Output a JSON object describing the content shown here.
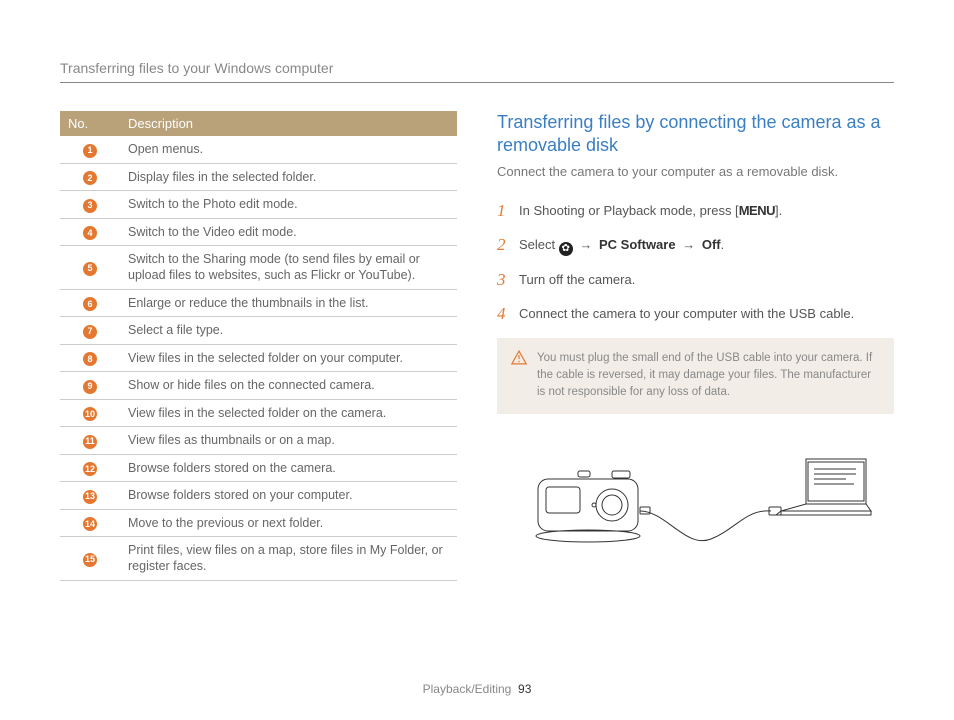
{
  "header_title": "Transferring files to your Windows computer",
  "table": {
    "headers": [
      "No.",
      "Description"
    ],
    "rows": [
      {
        "n": "1",
        "desc": "Open menus."
      },
      {
        "n": "2",
        "desc": "Display files in the selected folder."
      },
      {
        "n": "3",
        "desc": "Switch to the Photo edit mode."
      },
      {
        "n": "4",
        "desc": "Switch to the Video edit mode."
      },
      {
        "n": "5",
        "desc": "Switch to the Sharing mode (to send files by email or upload files to websites, such as Flickr or YouTube)."
      },
      {
        "n": "6",
        "desc": "Enlarge or reduce the thumbnails in the list."
      },
      {
        "n": "7",
        "desc": "Select a file type."
      },
      {
        "n": "8",
        "desc": "View files in the selected folder on your computer."
      },
      {
        "n": "9",
        "desc": "Show or hide files on the connected camera."
      },
      {
        "n": "10",
        "desc": "View files in the selected folder on the camera."
      },
      {
        "n": "11",
        "desc": "View files as thumbnails or on a map."
      },
      {
        "n": "12",
        "desc": "Browse folders stored on the camera."
      },
      {
        "n": "13",
        "desc": "Browse folders stored on your computer."
      },
      {
        "n": "14",
        "desc": "Move to the previous or next folder."
      },
      {
        "n": "15",
        "desc": "Print files, view files on a map, store files in My Folder, or register faces."
      }
    ]
  },
  "section": {
    "heading": "Transferring files by connecting the camera as a removable disk",
    "intro": "Connect the camera to your computer as a removable disk.",
    "steps": [
      {
        "n": "1",
        "pre": "In Shooting or Playback mode, press [",
        "key": "MENU",
        "post": "]."
      },
      {
        "n": "2",
        "select_label": "Select ",
        "gear": true,
        "arrow1": "→",
        "opt1": "PC Software",
        "arrow2": "→",
        "opt2": "Off",
        "post": "."
      },
      {
        "n": "3",
        "text": "Turn off the camera."
      },
      {
        "n": "4",
        "text": "Connect the camera to your computer with the USB cable."
      }
    ],
    "warning": "You must plug the small end of the USB cable into your camera. If the cable is reversed, it may damage your files. The manufacturer is not responsible for any loss of data."
  },
  "footer": {
    "section": "Playback/Editing",
    "page": "93"
  }
}
